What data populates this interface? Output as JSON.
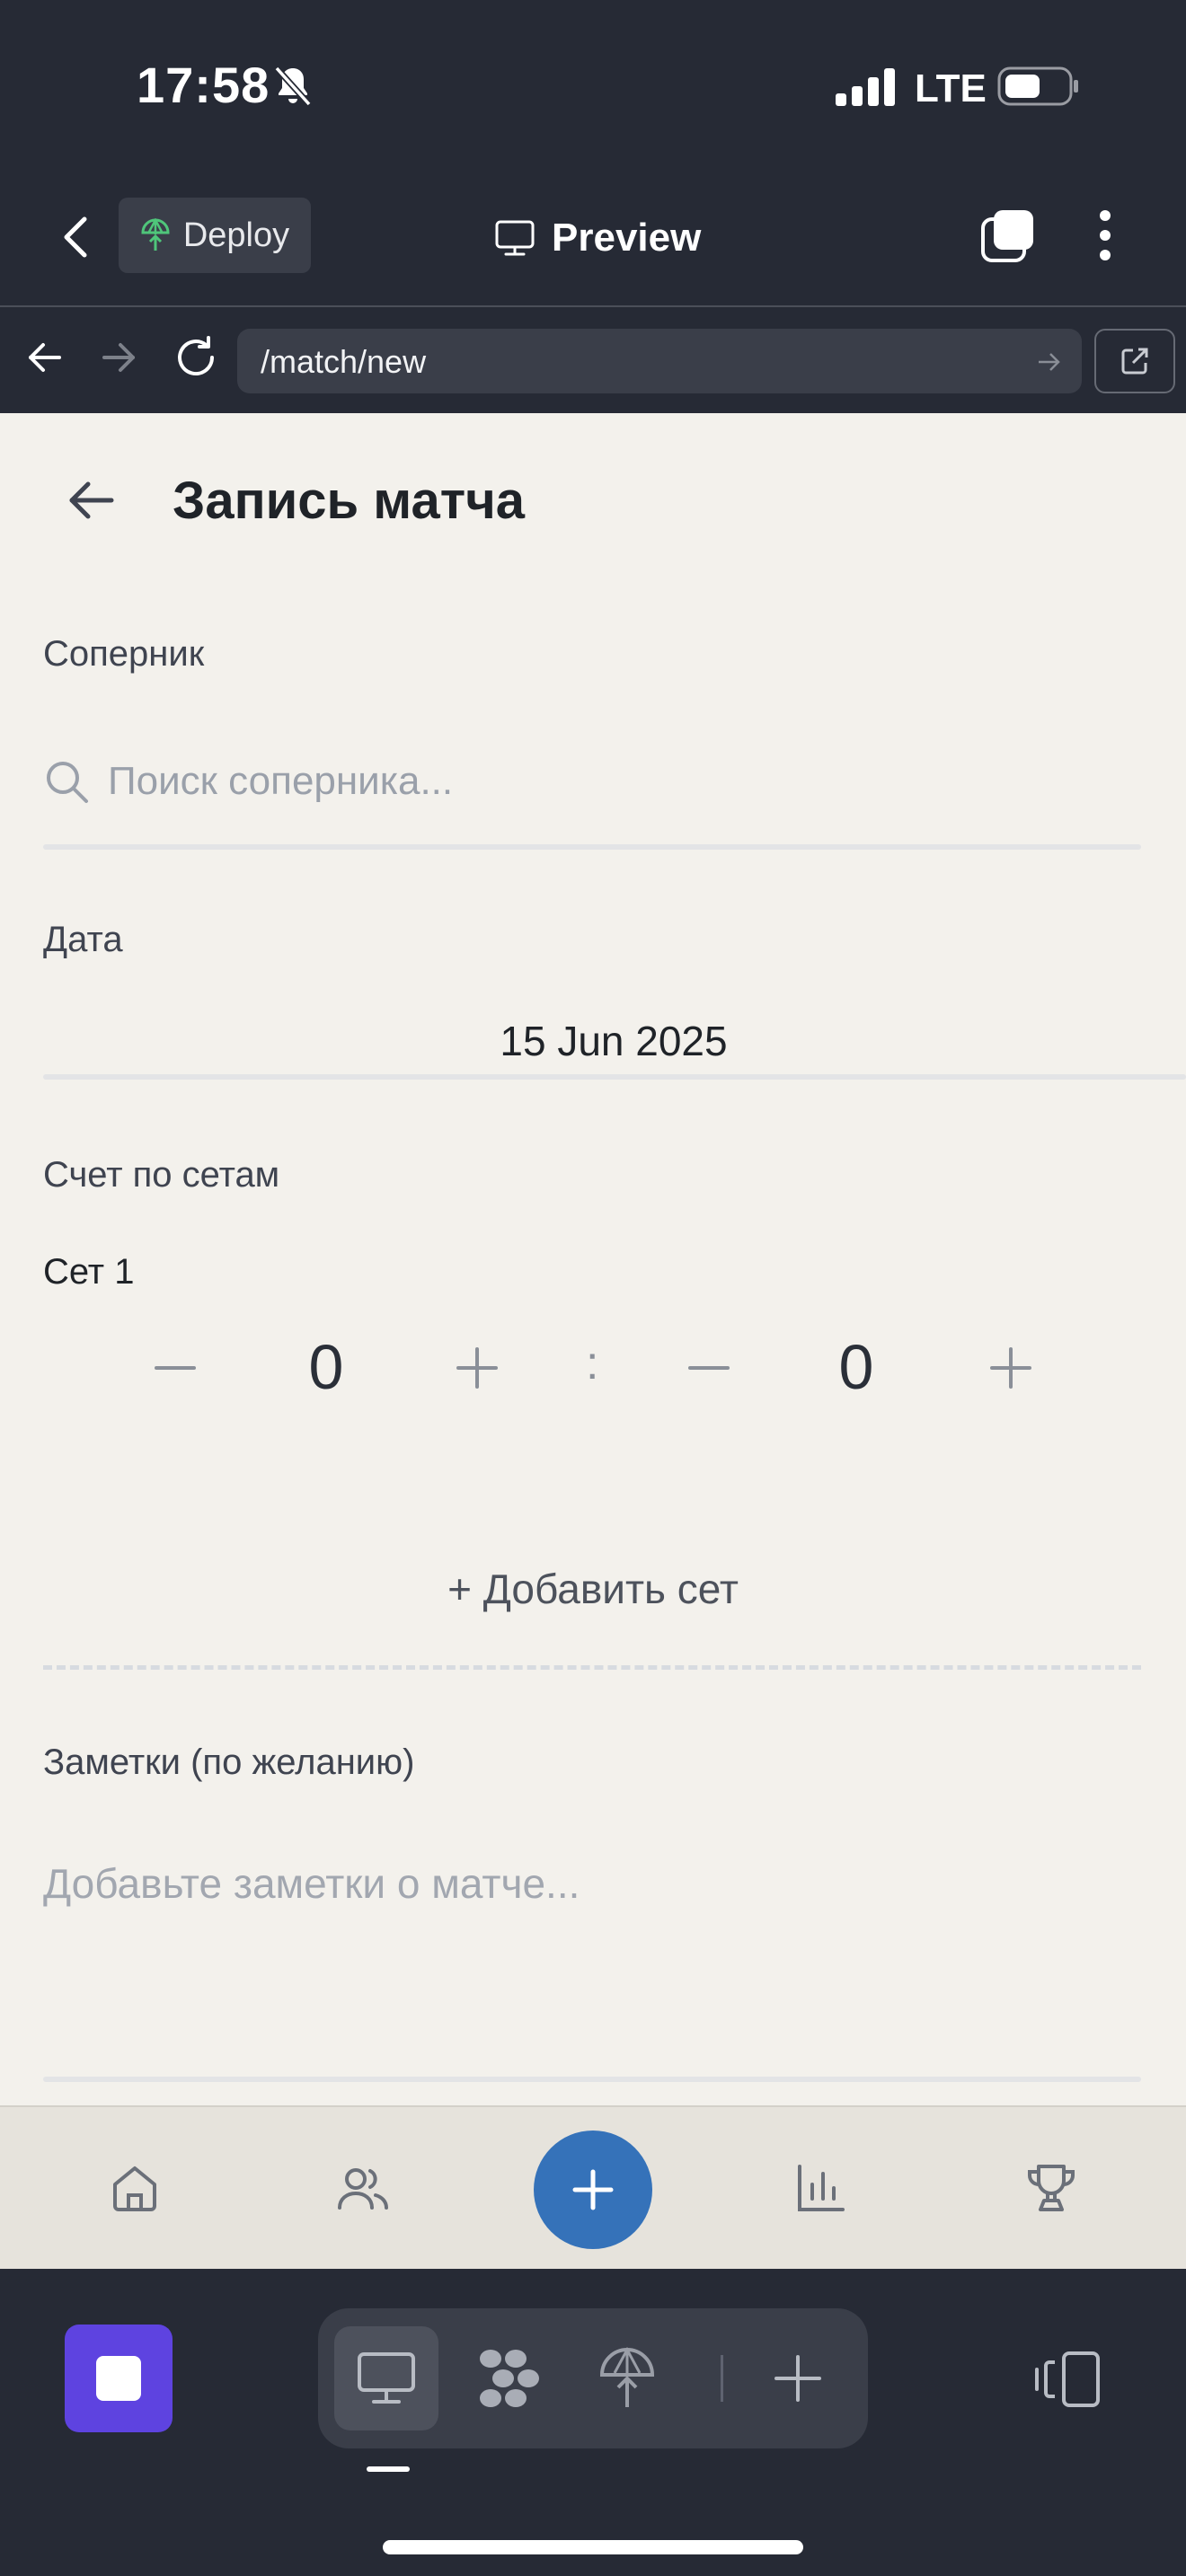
{
  "status_bar": {
    "time": "17:58",
    "network": "LTE",
    "icons": [
      "bell-slash-icon",
      "signal-icon",
      "battery-icon"
    ]
  },
  "app_toolbar": {
    "deploy_label": "Deploy",
    "preview_label": "Preview",
    "icons": [
      "back-icon",
      "deploy-icon",
      "monitor-icon",
      "tabs-icon",
      "more-icon"
    ]
  },
  "browser": {
    "url": "/match/new",
    "icons": [
      "nav-back-icon",
      "nav-forward-icon",
      "reload-icon",
      "url-go-icon",
      "open-external-icon"
    ]
  },
  "page": {
    "title": "Запись матча",
    "opponent": {
      "label": "Соперник",
      "placeholder": "Поиск соперника...",
      "value": ""
    },
    "date": {
      "label": "Дата",
      "value": "15 Jun 2025"
    },
    "score": {
      "label": "Счет по сетам",
      "sets": [
        {
          "label": "Сет 1",
          "player_score": "0",
          "opponent_score": "0"
        }
      ],
      "separator": ":",
      "add_set_label": "+ Добавить сет"
    },
    "notes": {
      "label": "Заметки (по желанию)",
      "placeholder": "Добавьте заметки о матче...",
      "value": ""
    }
  },
  "bottom_nav": {
    "items": [
      "home-icon",
      "users-icon",
      "plus-icon",
      "stats-icon",
      "trophy-icon"
    ],
    "accent_color": "#3572b9"
  },
  "dev_toolbar": {
    "stop_color": "#5e43e0",
    "modes": [
      "desktop-icon",
      "grid-icon",
      "deploy-icon",
      "plus-icon"
    ],
    "active_mode": "desktop-icon"
  }
}
